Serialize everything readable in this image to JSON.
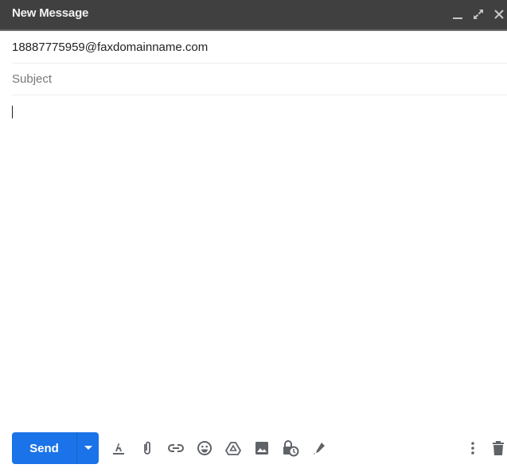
{
  "window": {
    "title": "New Message",
    "controls": [
      {
        "name": "minimize",
        "icon": "minimize-icon"
      },
      {
        "name": "fullscreen",
        "icon": "expand-icon"
      },
      {
        "name": "close",
        "icon": "close-icon"
      }
    ]
  },
  "compose": {
    "to_value": "18887775959@faxdomainname.com",
    "subject_placeholder": "Subject",
    "subject_value": "",
    "body_value": ""
  },
  "toolbar": {
    "send_label": "Send",
    "send_options_icon": "caret-down-icon",
    "tools": [
      {
        "name": "formatting-options",
        "icon": "text-format-icon"
      },
      {
        "name": "attach-files",
        "icon": "paperclip-icon"
      },
      {
        "name": "insert-link",
        "icon": "link-icon"
      },
      {
        "name": "insert-emoji",
        "icon": "emoji-icon"
      },
      {
        "name": "insert-drive-file",
        "icon": "drive-icon"
      },
      {
        "name": "insert-photo",
        "icon": "photo-icon"
      },
      {
        "name": "confidential-mode",
        "icon": "lock-clock-icon"
      },
      {
        "name": "insert-signature",
        "icon": "pen-icon"
      }
    ],
    "more_options_icon": "more-vert-icon",
    "discard_icon": "trash-icon"
  },
  "colors": {
    "titlebar": "#404040",
    "send_button": "#1a73e8",
    "icon_gray": "#5f6368"
  }
}
